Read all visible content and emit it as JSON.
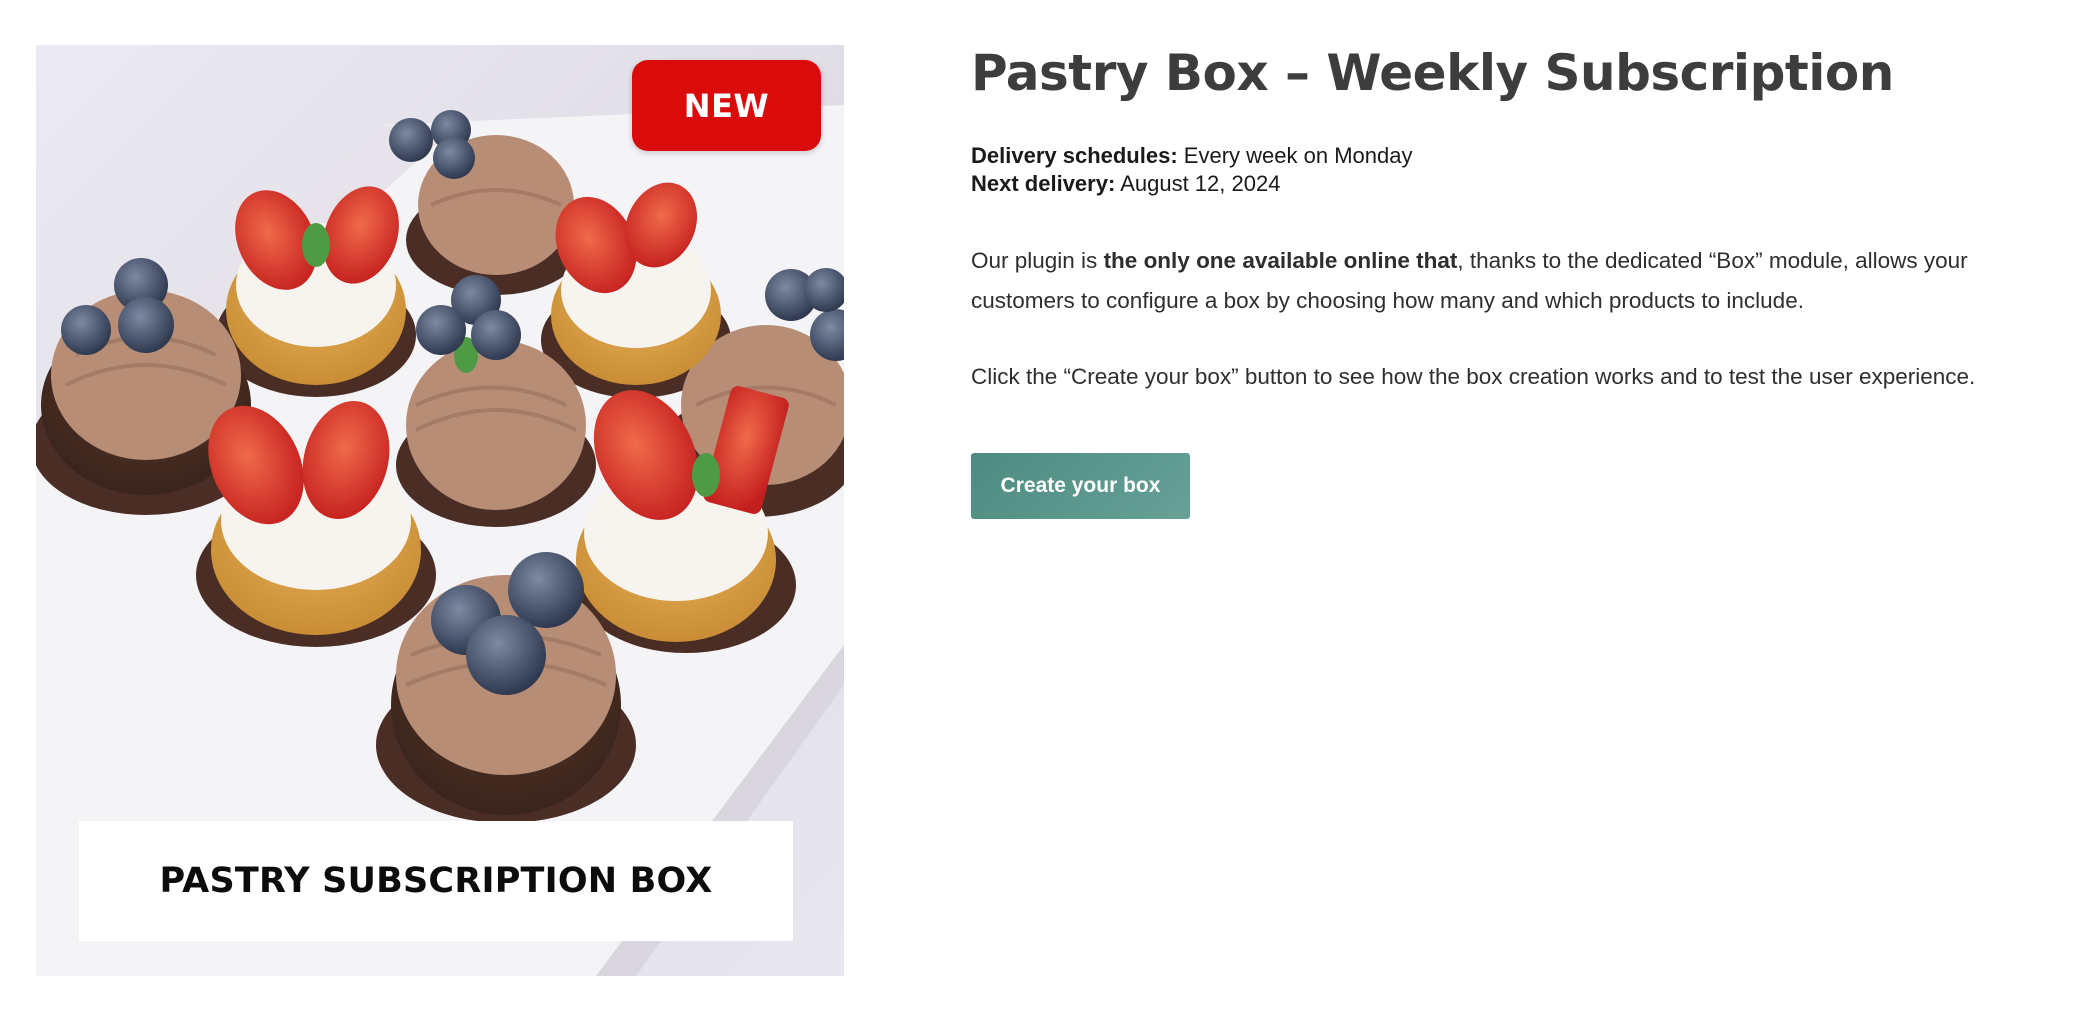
{
  "product": {
    "image": {
      "badge": "NEW",
      "caption": "PASTRY SUBSCRIPTION BOX"
    },
    "title": "Pastry Box – Weekly Subscription",
    "delivery": {
      "schedule_label": "Delivery schedules:",
      "schedule_value": "Every week on Monday",
      "next_label": "Next delivery:",
      "next_value": "August 12, 2024"
    },
    "description": {
      "prefix": "Our plugin is ",
      "emphasis": "the only one available online that",
      "suffix": ", thanks to the dedicated “Box” module, allows your customers to configure a box by choosing how many and which products to include."
    },
    "instruction": "Click the “Create your box” button to see how the box creation works and to test the user experience.",
    "cta_label": "Create your box"
  },
  "colors": {
    "badge_red": "#d90b0b",
    "cta_teal": "#5a978d",
    "title_gray": "#3d3d3d"
  },
  "icons": [
    "cupcake-box-illustration"
  ]
}
